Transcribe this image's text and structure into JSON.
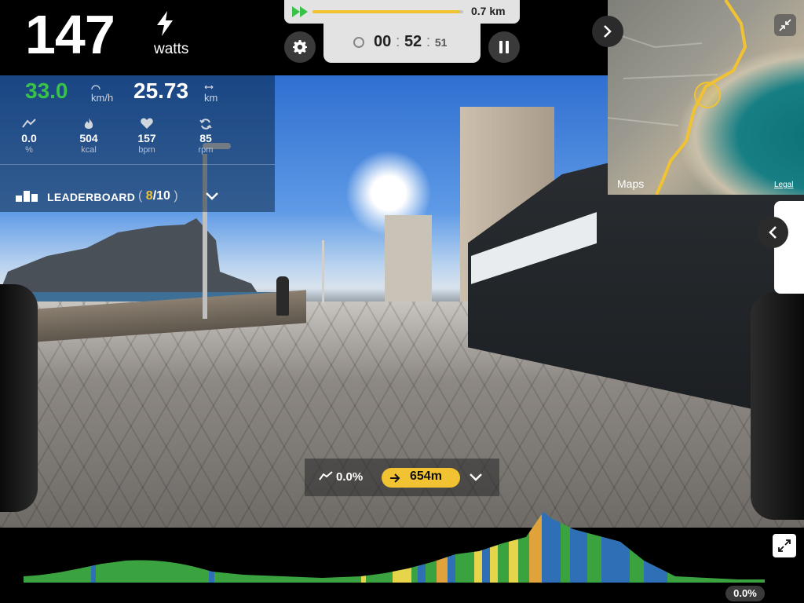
{
  "power": {
    "value": "147",
    "unit": "watts",
    "icon": "bolt-icon"
  },
  "progress": {
    "distance": "0.7 km",
    "fraction": 0.98,
    "icon": "fast-forward-icon",
    "color": "#f1c232"
  },
  "timer": {
    "hours": "00",
    "minutes": "52",
    "seconds": "51",
    "sep": ":",
    "icon": "clock-icon"
  },
  "stats": {
    "speed": {
      "value": "33.0",
      "unit": "km/h",
      "color": "#38c24a"
    },
    "distance": {
      "value": "25.73",
      "unit": "km"
    },
    "grade": {
      "value": "0.0",
      "unit": "%",
      "icon": "incline-icon"
    },
    "calories": {
      "value": "504",
      "unit": "kcal",
      "icon": "flame-icon"
    },
    "heart_rate": {
      "value": "157",
      "unit": "bpm",
      "icon": "heart-icon"
    },
    "cadence": {
      "value": "85",
      "unit": "rpm",
      "icon": "cadence-icon"
    }
  },
  "leaderboard": {
    "label": "LEADERBOARD",
    "open": "(",
    "rank": "8",
    "slash": "/",
    "total": "10",
    "close": ")",
    "icon": "leaderboard-icon"
  },
  "map": {
    "provider_label": "Maps",
    "legal_label": "Legal"
  },
  "gradient_bar": {
    "grade": "0.0%",
    "remaining": "654m"
  },
  "profile": {
    "grade": "0.0%"
  },
  "colors": {
    "accent": "#f1c232",
    "green": "#38c24a",
    "blue": "#2f6fb5",
    "orange": "#e0a23a",
    "yellow": "#e6d54a"
  }
}
